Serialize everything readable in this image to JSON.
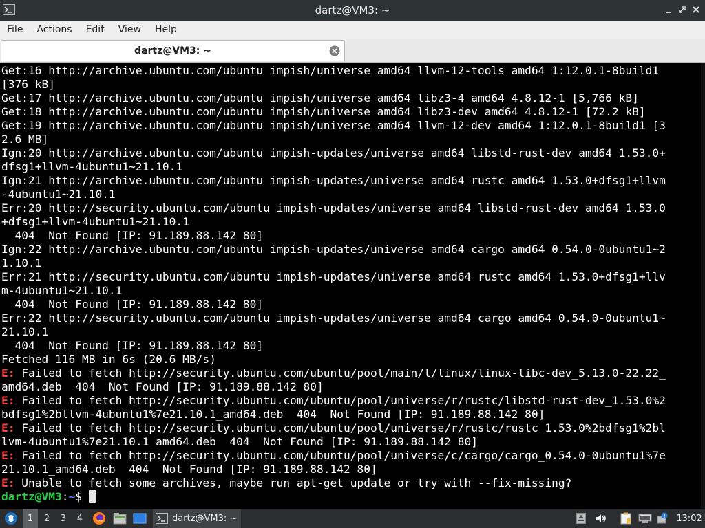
{
  "window": {
    "title": "dartz@VM3: ~"
  },
  "menu": {
    "items": [
      "File",
      "Actions",
      "Edit",
      "View",
      "Help"
    ]
  },
  "tabs": [
    {
      "label": "dartz@VM3: ~"
    }
  ],
  "terminal": {
    "lines": [
      {
        "text": "Get:16 http://archive.ubuntu.com/ubuntu impish/universe amd64 llvm-12-tools amd64 1:12.0.1-8build1"
      },
      {
        "text": "[376 kB]"
      },
      {
        "text": "Get:17 http://archive.ubuntu.com/ubuntu impish/universe amd64 libz3-4 amd64 4.8.12-1 [5,766 kB]"
      },
      {
        "text": "Get:18 http://archive.ubuntu.com/ubuntu impish/universe amd64 libz3-dev amd64 4.8.12-1 [72.2 kB]"
      },
      {
        "text": "Get:19 http://archive.ubuntu.com/ubuntu impish/universe amd64 llvm-12-dev amd64 1:12.0.1-8build1 [3"
      },
      {
        "text": "2.6 MB]"
      },
      {
        "text": "Ign:20 http://archive.ubuntu.com/ubuntu impish-updates/universe amd64 libstd-rust-dev amd64 1.53.0+"
      },
      {
        "text": "dfsg1+llvm-4ubuntu1~21.10.1"
      },
      {
        "text": "Ign:21 http://archive.ubuntu.com/ubuntu impish-updates/universe amd64 rustc amd64 1.53.0+dfsg1+llvm"
      },
      {
        "text": "-4ubuntu1~21.10.1"
      },
      {
        "text": "Err:20 http://security.ubuntu.com/ubuntu impish-updates/universe amd64 libstd-rust-dev amd64 1.53.0"
      },
      {
        "text": "+dfsg1+llvm-4ubuntu1~21.10.1"
      },
      {
        "text": "  404  Not Found [IP: 91.189.88.142 80]"
      },
      {
        "text": "Ign:22 http://archive.ubuntu.com/ubuntu impish-updates/universe amd64 cargo amd64 0.54.0-0ubuntu1~2"
      },
      {
        "text": "1.10.1"
      },
      {
        "text": "Err:21 http://security.ubuntu.com/ubuntu impish-updates/universe amd64 rustc amd64 1.53.0+dfsg1+llv"
      },
      {
        "text": "m-4ubuntu1~21.10.1"
      },
      {
        "text": "  404  Not Found [IP: 91.189.88.142 80]"
      },
      {
        "text": "Err:22 http://security.ubuntu.com/ubuntu impish-updates/universe amd64 cargo amd64 0.54.0-0ubuntu1~"
      },
      {
        "text": "21.10.1"
      },
      {
        "text": "  404  Not Found [IP: 91.189.88.142 80]"
      },
      {
        "text": "Fetched 116 MB in 6s (20.6 MB/s)"
      },
      {
        "prefix": "E:",
        "text": " Failed to fetch http://security.ubuntu.com/ubuntu/pool/main/l/linux/linux-libc-dev_5.13.0-22.22_"
      },
      {
        "text": "amd64.deb  404  Not Found [IP: 91.189.88.142 80]"
      },
      {
        "prefix": "E:",
        "text": " Failed to fetch http://security.ubuntu.com/ubuntu/pool/universe/r/rustc/libstd-rust-dev_1.53.0%2"
      },
      {
        "text": "bdfsg1%2bllvm-4ubuntu1%7e21.10.1_amd64.deb  404  Not Found [IP: 91.189.88.142 80]"
      },
      {
        "prefix": "E:",
        "text": " Failed to fetch http://security.ubuntu.com/ubuntu/pool/universe/r/rustc/rustc_1.53.0%2bdfsg1%2bl"
      },
      {
        "text": "lvm-4ubuntu1%7e21.10.1_amd64.deb  404  Not Found [IP: 91.189.88.142 80]"
      },
      {
        "prefix": "E:",
        "text": " Failed to fetch http://security.ubuntu.com/ubuntu/pool/universe/c/cargo/cargo_0.54.0-0ubuntu1%7e"
      },
      {
        "text": "21.10.1_amd64.deb  404  Not Found [IP: 91.189.88.142 80]"
      },
      {
        "prefix": "E:",
        "text": " Unable to fetch some archives, maybe run apt-get update or try with --fix-missing?"
      }
    ],
    "prompt": {
      "user_host": "dartz@VM3",
      "sep": ":",
      "path": "~",
      "symbol": "$ "
    }
  },
  "taskbar": {
    "workspaces": [
      "1",
      "2",
      "3",
      "4"
    ],
    "active_workspace": "1",
    "launchers": [
      "start-menu-icon",
      "firefox-icon",
      "file-manager-icon",
      "show-desktop-icon"
    ],
    "task": {
      "label": "dartz@VM3: ~"
    },
    "tray": [
      "eject-icon",
      "volume-icon",
      "clipboard-icon",
      "network-icon",
      "update-notifier-icon"
    ],
    "clock": "13:02"
  },
  "colors": {
    "error_prefix": "#ff3b3b",
    "prompt_user": "#22d040",
    "prompt_path": "#4a7fff",
    "terminal_bg": "#000000",
    "titlebar_bg": "#2e3436",
    "taskbar_bg": "#2c2d2f"
  }
}
